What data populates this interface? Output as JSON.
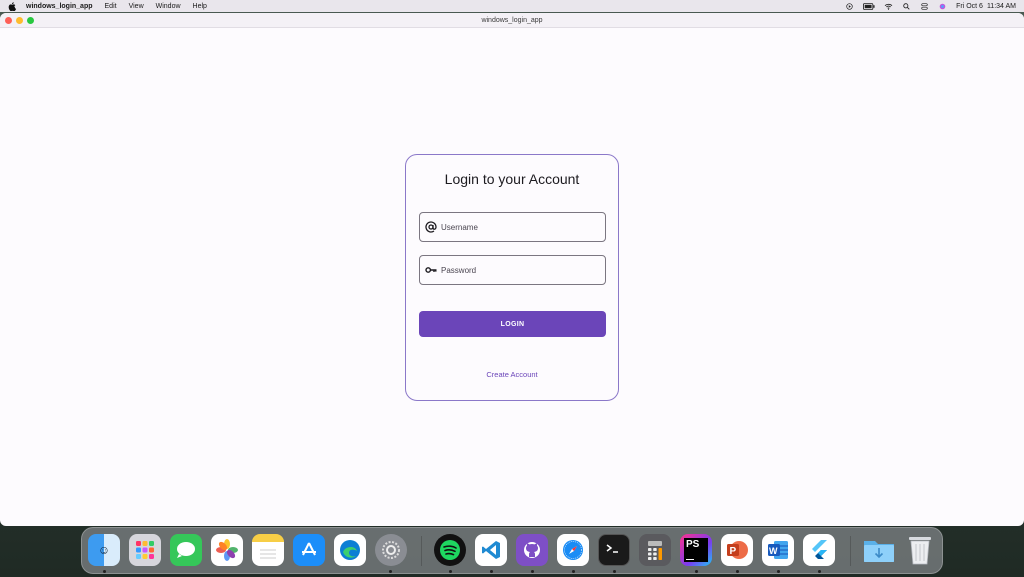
{
  "menubar": {
    "app_name": "windows_login_app",
    "items": [
      "Edit",
      "View",
      "Window",
      "Help"
    ],
    "date": "Fri Oct 6",
    "time": "11:34 AM"
  },
  "window": {
    "title": "windows_login_app"
  },
  "login": {
    "title": "Login to your Account",
    "username_placeholder": "Username",
    "password_placeholder": "Password",
    "login_label": "LOGIN",
    "create_account_label": "Create Account",
    "accent_color": "#6b45b9"
  },
  "dock": {
    "apps": [
      "finder",
      "launchpad",
      "messages",
      "photos",
      "notes",
      "app-store",
      "edge",
      "system-settings",
      "spotify",
      "vscode",
      "github-desktop",
      "safari",
      "terminal",
      "calculator",
      "phpstorm",
      "powerpoint",
      "word",
      "flutter",
      "downloads",
      "trash"
    ]
  }
}
